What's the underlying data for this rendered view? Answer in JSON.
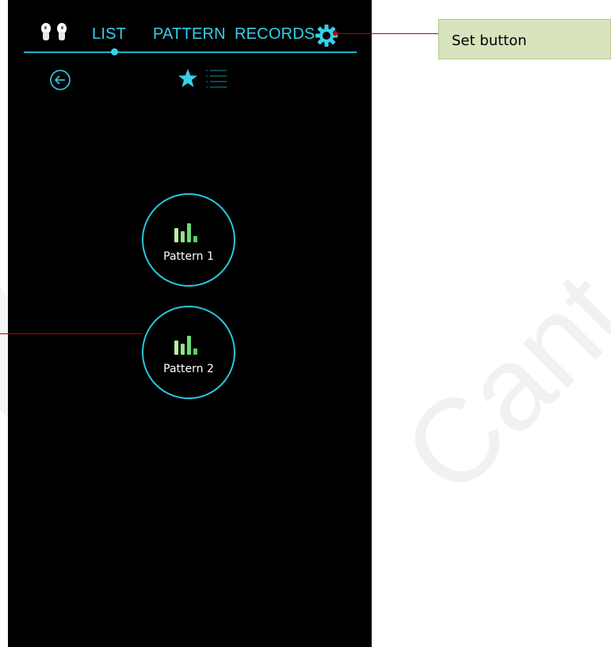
{
  "app": {
    "tabs": [
      {
        "label": "LIST"
      },
      {
        "label": "PATTERN"
      },
      {
        "label": "RECORDS"
      }
    ],
    "active_tab": "LIST",
    "icons": {
      "left": "earbuds-icon",
      "settings": "gear-icon",
      "back": "back-arrow-icon",
      "favorites": "star-icon",
      "list": "list-icon",
      "pattern": "equalizer-bars-icon"
    },
    "patterns": [
      {
        "label": "Pattern 1"
      },
      {
        "label": "Pattern 2"
      }
    ]
  },
  "annotation": {
    "callout_text": "Set button"
  },
  "watermark": {
    "text": "Cant"
  },
  "colors": {
    "accent": "#35d0ea",
    "background": "#000000",
    "bar_green_light": "#b7f0a0",
    "bar_green": "#4fd267",
    "callout_bg": "#d8e4bd",
    "leader_line": "#c00000"
  }
}
